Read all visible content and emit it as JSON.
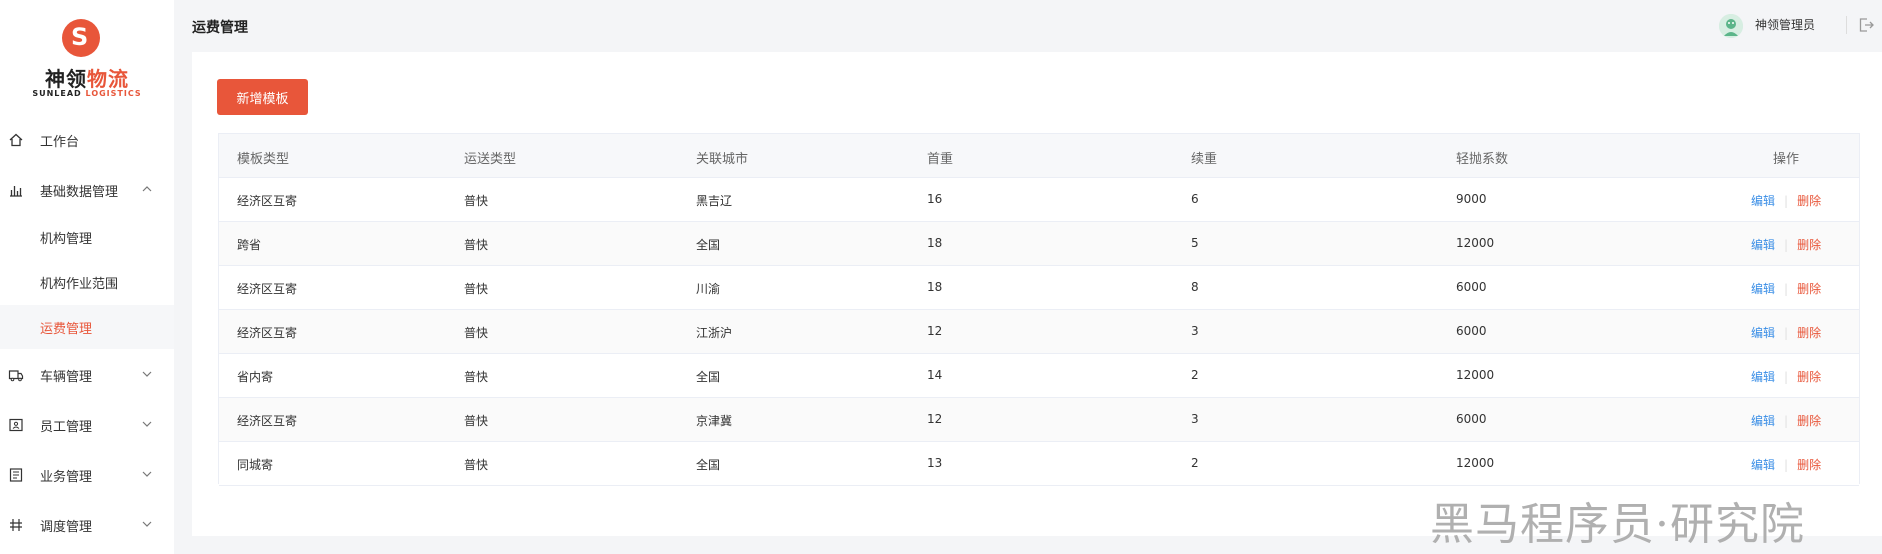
{
  "brand": {
    "cn_part1": "神领",
    "cn_part2": "物流",
    "en_part1": "SUNLEAD",
    "en_part2": "LOGISTICS",
    "accent": "#e8563a"
  },
  "sidebar": {
    "items": [
      {
        "label": "工作台",
        "icon": "home-icon"
      },
      {
        "label": "基础数据管理",
        "icon": "bar-chart-icon",
        "expanded": true,
        "children": [
          {
            "label": "机构管理"
          },
          {
            "label": "机构作业范围"
          },
          {
            "label": "运费管理",
            "active": true
          }
        ]
      },
      {
        "label": "车辆管理",
        "icon": "truck-icon"
      },
      {
        "label": "员工管理",
        "icon": "id-card-icon"
      },
      {
        "label": "业务管理",
        "icon": "book-icon"
      },
      {
        "label": "调度管理",
        "icon": "dispatch-icon"
      }
    ]
  },
  "header": {
    "title": "运费管理",
    "user_name": "神领管理员"
  },
  "toolbar": {
    "add_label": "新增模板"
  },
  "table": {
    "columns": [
      "模板类型",
      "运送类型",
      "关联城市",
      "首重",
      "续重",
      "轻抛系数",
      "操作"
    ],
    "rows": [
      [
        "经济区互寄",
        "普快",
        "黑吉辽",
        "16",
        "6",
        "9000"
      ],
      [
        "跨省",
        "普快",
        "全国",
        "18",
        "5",
        "12000"
      ],
      [
        "经济区互寄",
        "普快",
        "川渝",
        "18",
        "8",
        "6000"
      ],
      [
        "经济区互寄",
        "普快",
        "江浙沪",
        "12",
        "3",
        "6000"
      ],
      [
        "省内寄",
        "普快",
        "全国",
        "14",
        "2",
        "12000"
      ],
      [
        "经济区互寄",
        "普快",
        "京津冀",
        "12",
        "3",
        "6000"
      ],
      [
        "同城寄",
        "普快",
        "全国",
        "13",
        "2",
        "12000"
      ]
    ],
    "edit_label": "编辑",
    "delete_label": "删除",
    "separator": "|"
  },
  "watermark": "黑马程序员·研究院"
}
